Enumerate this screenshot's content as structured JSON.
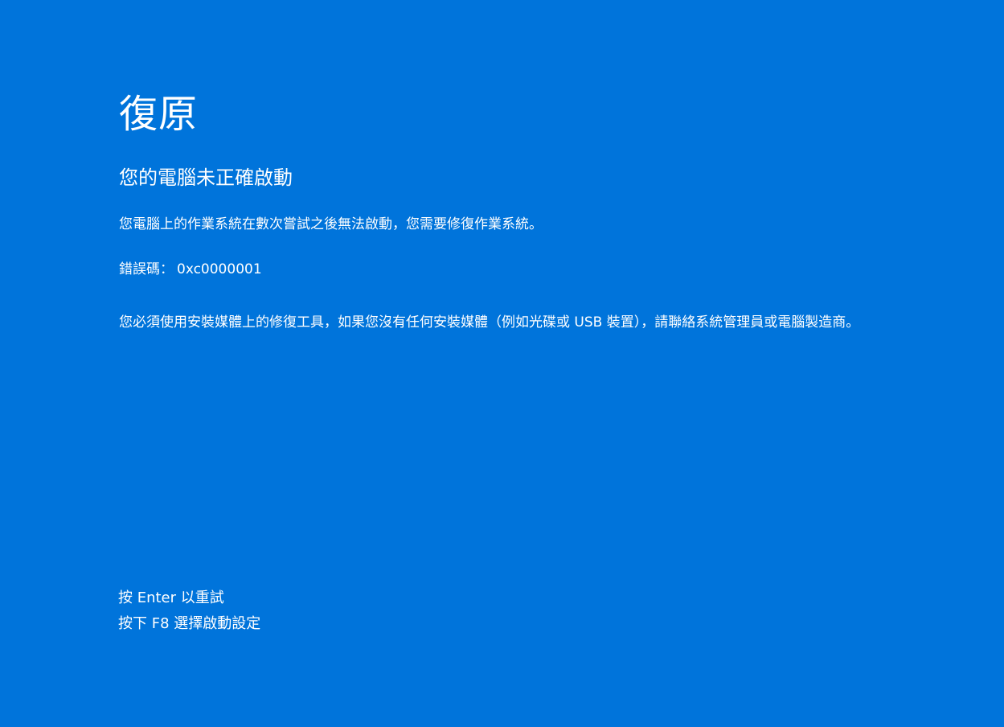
{
  "recovery": {
    "title": "復原",
    "subtitle": "您的電腦未正確啟動",
    "description": "您電腦上的作業系統在數次嘗試之後無法啟動，您需要修復作業系統。",
    "error_label": "錯誤碼：",
    "error_code": "0xc0000001",
    "advice": "您必須使用安裝媒體上的修復工具，如果您沒有任何安裝媒體（例如光碟或 USB 裝置），請聯絡系統管理員或電腦製造商。"
  },
  "key_hints": [
    {
      "label": "按 Enter 以重試"
    },
    {
      "label": "按下 F8 選擇啟動設定"
    }
  ],
  "colors": {
    "background": "#0074db",
    "text": "#ffffff"
  }
}
